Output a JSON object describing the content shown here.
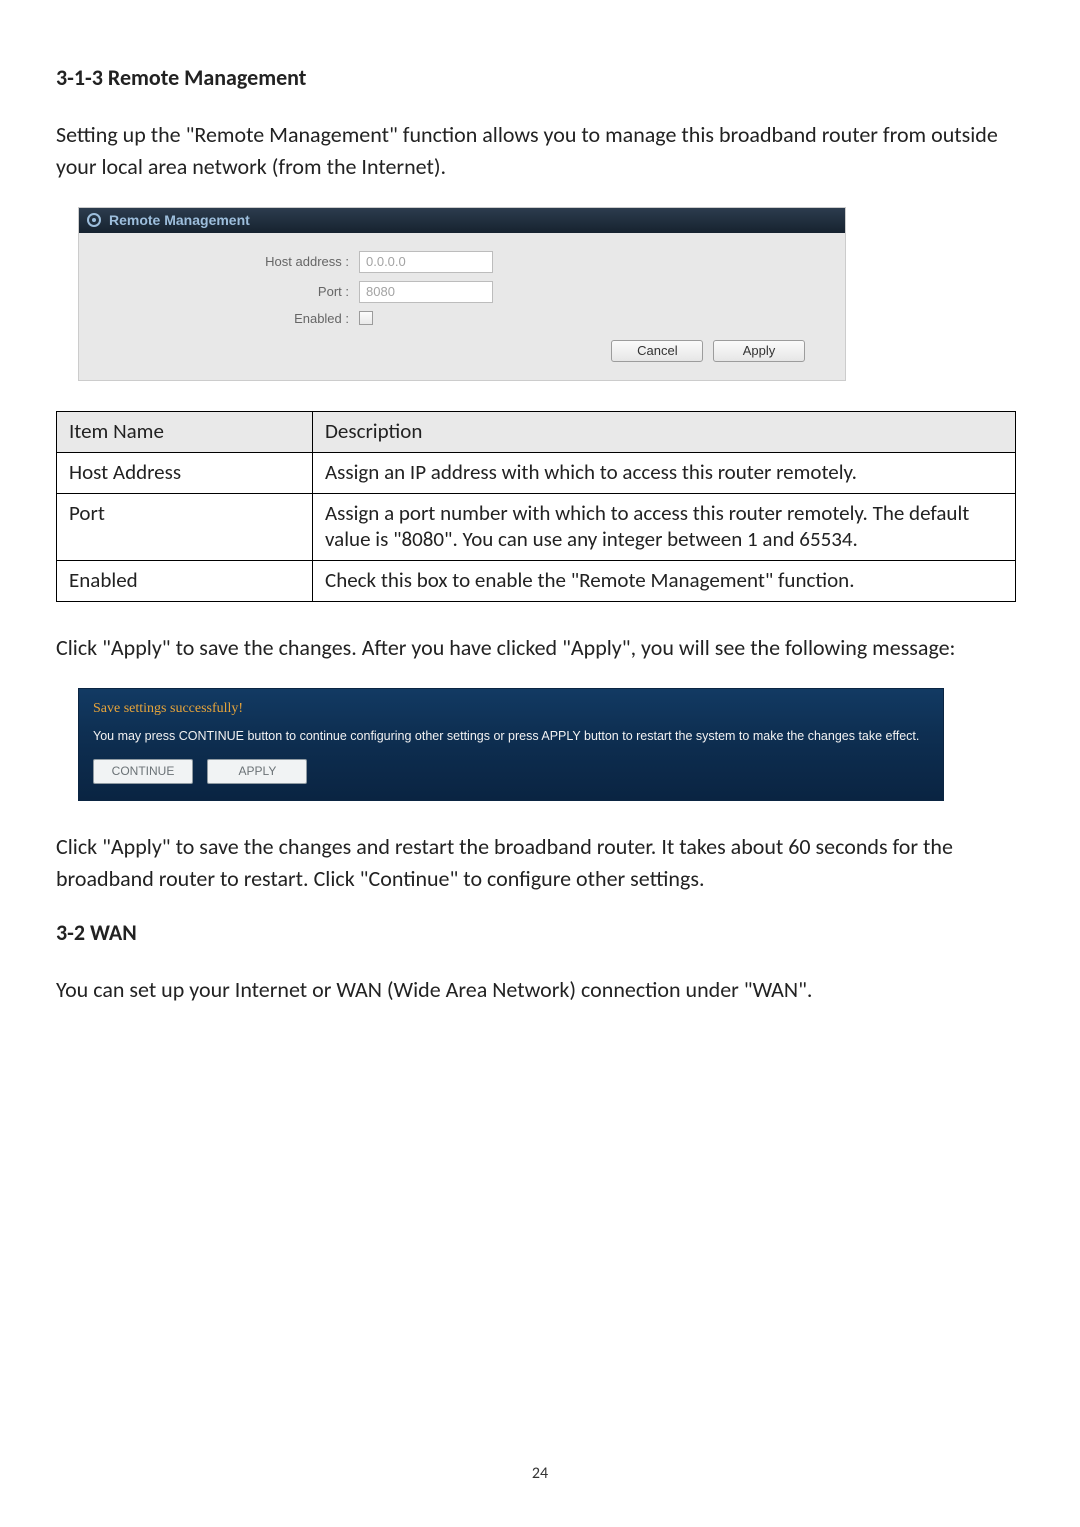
{
  "heading_1": "3-1-3 Remote Management",
  "intro_1": "Setting up the \"Remote Management\" function allows you to manage this broadband router from outside your local area network (from the Internet).",
  "rm_panel": {
    "header": "Remote Management",
    "host_label": "Host address :",
    "host_value": "0.0.0.0",
    "port_label": "Port :",
    "port_value": "8080",
    "enabled_label": "Enabled :",
    "enabled_checked": false,
    "cancel_label": "Cancel",
    "apply_label": "Apply"
  },
  "desc_table": {
    "headers": {
      "name": "Item Name",
      "desc": "Description"
    },
    "rows": [
      {
        "name": "Host Address",
        "desc": "Assign an IP address with which to access this router remotely."
      },
      {
        "name": "Port",
        "desc": "Assign a port number with which to access this router remotely. The default value is \"8080\". You can use any integer between 1 and 65534."
      },
      {
        "name": "Enabled",
        "desc": "Check this box to enable the \"Remote Management\" function."
      }
    ]
  },
  "after_table_text": "Click \"Apply\" to save the changes. After you have clicked \"Apply\", you will see the following message:",
  "save_panel": {
    "title": "Save settings successfully!",
    "message": "You may press CONTINUE button to continue configuring other settings or press APPLY button to restart the system to make the changes take effect.",
    "continue_label": "CONTINUE",
    "apply_label": "APPLY"
  },
  "after_save_text": "Click \"Apply\" to save the changes and restart the broadband router. It takes about 60 seconds for the broadband router to restart. Click \"Continue\" to configure other settings.",
  "heading_2": "3-2 WAN",
  "wan_text": "You can set up your Internet or WAN (Wide Area Network) connection under \"WAN\".",
  "page_number": "24"
}
